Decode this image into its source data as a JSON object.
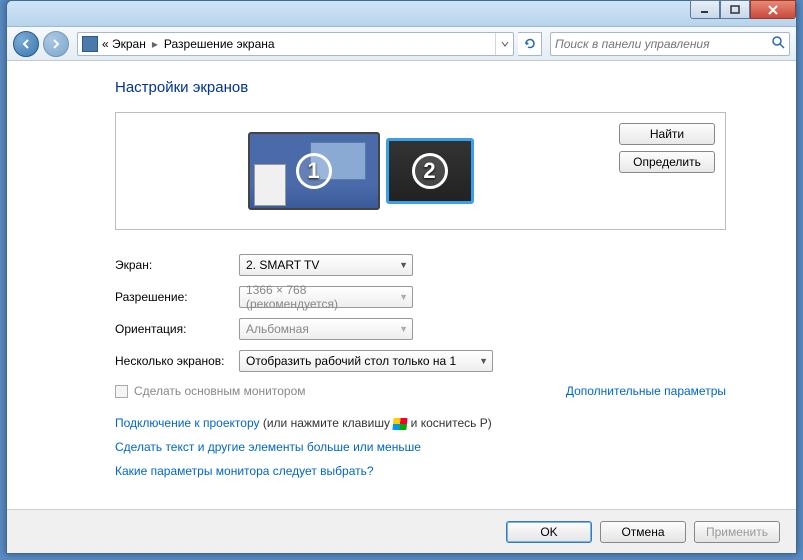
{
  "titlebar": {},
  "nav": {
    "breadcrumb_prefix": "« Экран",
    "breadcrumb_current": "Разрешение экрана",
    "search_placeholder": "Поиск в панели управления"
  },
  "heading": "Настройки экранов",
  "monitors": {
    "m1_num": "1",
    "m2_num": "2"
  },
  "side_buttons": {
    "find": "Найти",
    "identify": "Определить"
  },
  "form": {
    "screen_label": "Экран:",
    "screen_value": "2. SMART TV",
    "resolution_label": "Разрешение:",
    "resolution_value": "1366 × 768 (рекомендуется)",
    "orientation_label": "Ориентация:",
    "orientation_value": "Альбомная",
    "multi_label": "Несколько экранов:",
    "multi_value": "Отобразить рабочий стол только на 1"
  },
  "checkbox": {
    "label": "Сделать основным монитором"
  },
  "advanced_link": "Дополнительные параметры",
  "links": {
    "projector": "Подключение к проектору",
    "projector_hint_pre": " (или нажмите клавишу ",
    "projector_hint_post": " и коснитесь P)",
    "text_size": "Сделать текст и другие элементы больше или меньше",
    "which_params": "Какие параметры монитора следует выбрать?"
  },
  "footer": {
    "ok": "OK",
    "cancel": "Отмена",
    "apply": "Применить"
  }
}
